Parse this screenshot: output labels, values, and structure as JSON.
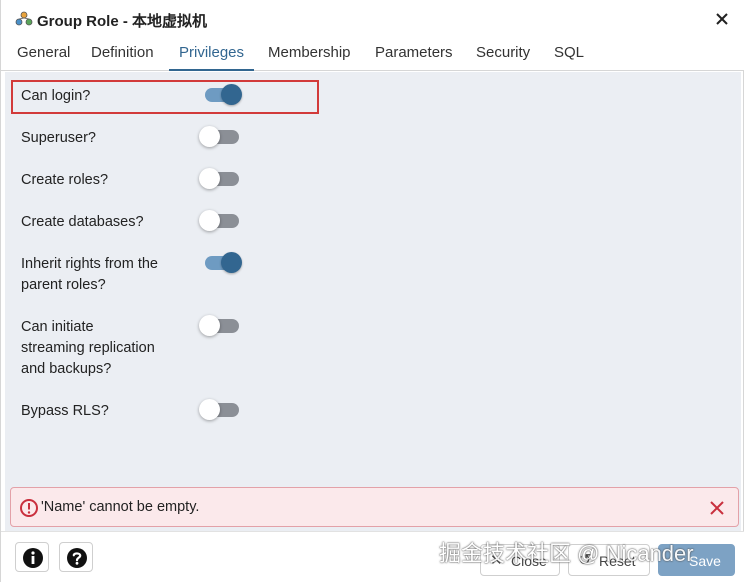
{
  "window": {
    "title": "Group Role - 本地虚拟机"
  },
  "tabs": [
    {
      "label": "General"
    },
    {
      "label": "Definition"
    },
    {
      "label": "Privileges",
      "active": true
    },
    {
      "label": "Membership"
    },
    {
      "label": "Parameters"
    },
    {
      "label": "Security"
    },
    {
      "label": "SQL"
    }
  ],
  "privileges": {
    "can_login": {
      "label": "Can login?",
      "on": true
    },
    "superuser": {
      "label": "Superuser?",
      "on": false
    },
    "create_roles": {
      "label": "Create roles?",
      "on": false
    },
    "create_databases": {
      "label": "Create databases?",
      "on": false
    },
    "inherit": {
      "label_line1": "Inherit rights from the",
      "label_line2": "parent roles?",
      "on": true
    },
    "replication": {
      "label_line1": "Can initiate",
      "label_line2": "streaming replication",
      "label_line3": "and backups?",
      "on": false
    },
    "bypass_rls": {
      "label": "Bypass RLS?",
      "on": false
    }
  },
  "error": {
    "message": "'Name' cannot be empty."
  },
  "footer": {
    "info_icon": "info-icon",
    "help_icon": "help-icon",
    "close_label": "Close",
    "reset_label": "Reset",
    "save_label": "Save"
  },
  "watermark": "掘金技术社区 @ Nicander",
  "colors": {
    "accent": "#326690",
    "toggle_on_track": "#6e9bc2",
    "toggle_off_track": "#8b8f96",
    "error_border": "#e3a1a8",
    "error_bg": "#fbe9eb",
    "error_icon": "#c9303e",
    "highlight": "#d23a3a",
    "panel_bg": "#ebeef3"
  }
}
